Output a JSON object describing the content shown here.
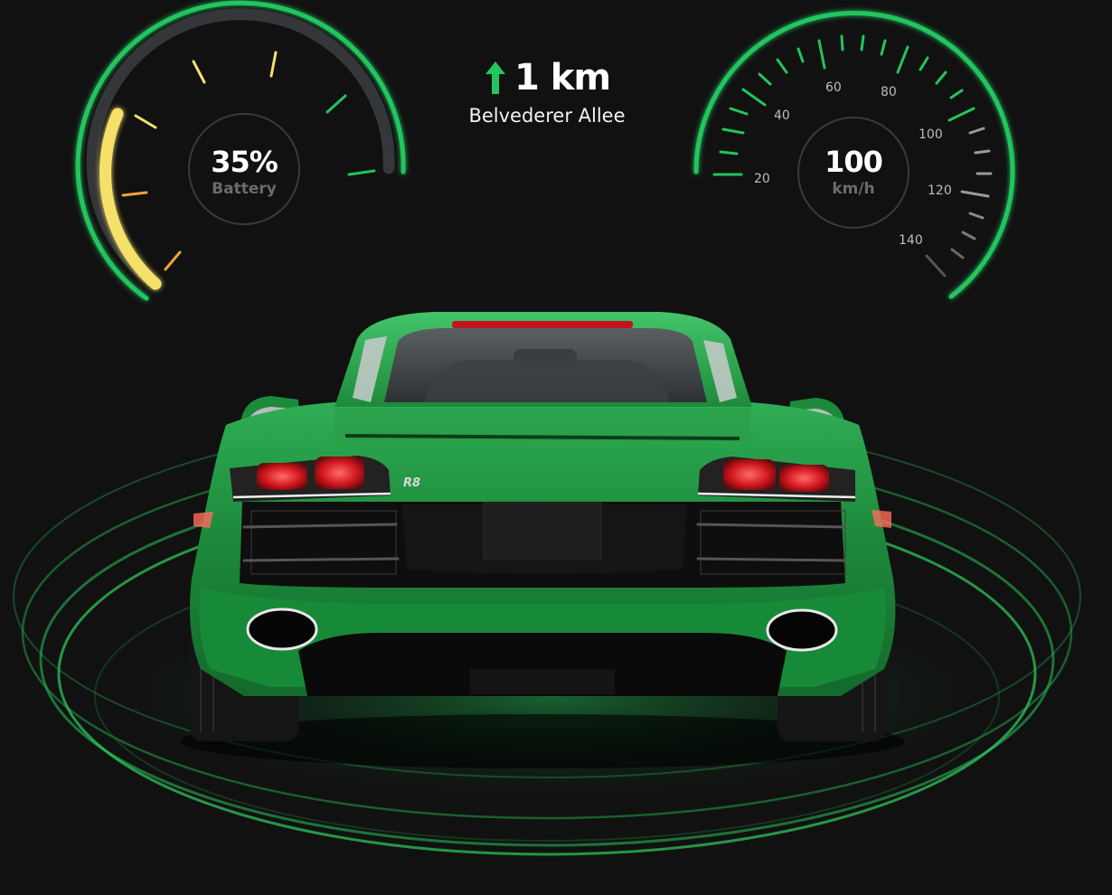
{
  "battery": {
    "value": "35%",
    "label": "Battery",
    "level": 0.35
  },
  "navigation": {
    "distance": "1 km",
    "street": "Belvederer Allee",
    "direction_icon": "arrow-up-icon"
  },
  "speed": {
    "value": "100",
    "unit": "km/h",
    "scale_labels": [
      "20",
      "40",
      "60",
      "80",
      "100",
      "120",
      "140"
    ]
  },
  "car": {
    "badge": "R8"
  },
  "colors": {
    "accent_green": "#22c55e",
    "battery_yellow": "#f5e06a",
    "battery_orange": "#f0a23a",
    "car_body": "#1e8a3c",
    "tail_light": "#e8232b",
    "background": "#111111"
  }
}
